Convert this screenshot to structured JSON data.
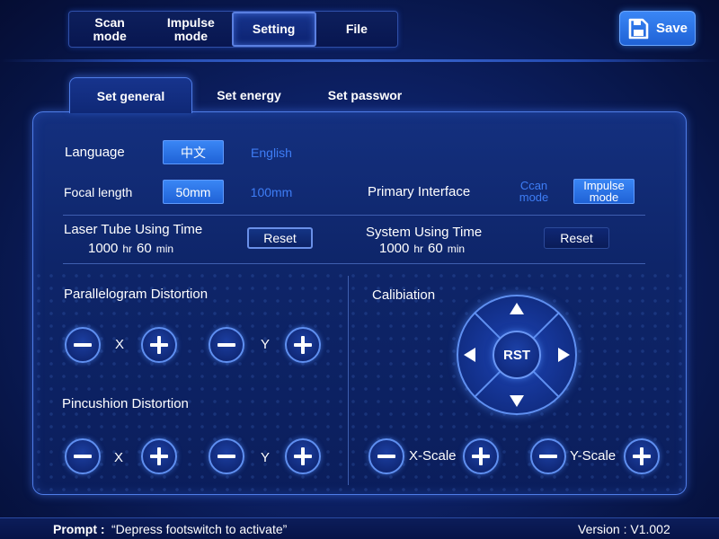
{
  "nav": {
    "tabs": [
      {
        "label": "Scan\nmode"
      },
      {
        "label": "Impulse\nmode"
      },
      {
        "label": "Setting"
      },
      {
        "label": "File"
      }
    ],
    "active_tab": "Setting",
    "save_label": "Save"
  },
  "subtabs": {
    "general": "Set general",
    "energy": "Set energy",
    "password": "Set passwor",
    "active": "Set general"
  },
  "general": {
    "language_label": "Language",
    "language_options": [
      "中文",
      "English"
    ],
    "language_selected": "中文",
    "focal_label": "Focal length",
    "focal_options": [
      "50mm",
      "100mm"
    ],
    "focal_selected": "50mm",
    "primary_label": "Primary Interface",
    "primary_options": [
      "Ccan\nmode",
      "Impulse\nmode"
    ],
    "primary_selected": "Impulse\nmode",
    "laser_tube": {
      "label": "Laser Tube Using Time",
      "hours": "1000",
      "hr_unit": "hr",
      "minutes": "60",
      "min_unit": "min",
      "reset_label": "Reset"
    },
    "system": {
      "label": "System Using Time",
      "hours": "1000",
      "hr_unit": "hr",
      "minutes": "60",
      "min_unit": "min",
      "reset_label": "Reset"
    },
    "parallelogram_label": "Parallelogram Distortion",
    "pincushion_label": "Pincushion Distortion",
    "x_label": "X",
    "y_label": "Y",
    "calibration_label": "Calibiation",
    "rst_label": "RST",
    "x_scale_label": "X-Scale",
    "y_scale_label": "Y-Scale"
  },
  "footer": {
    "prompt_label": "Prompt :",
    "prompt_text": "“Depress footswitch to activate”",
    "version": "Version : V1.002"
  },
  "colors": {
    "accent": "#3a86f5",
    "link": "#3e7df5",
    "background": "#0a1a4e"
  }
}
